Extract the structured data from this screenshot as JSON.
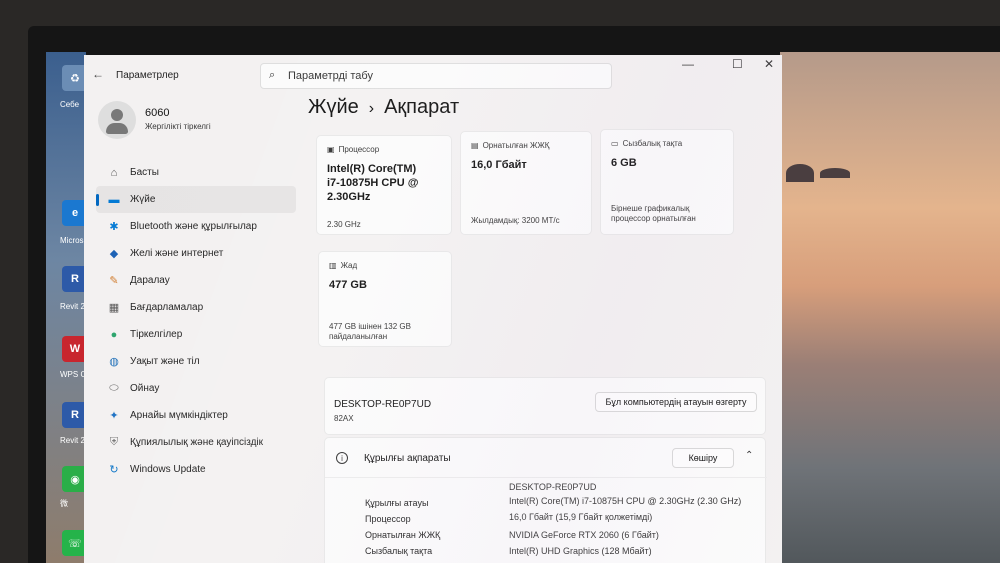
{
  "window": {
    "app_title": "Параметрлер",
    "search_placeholder": "Параметрді табу"
  },
  "user": {
    "name": "6060",
    "account_type": "Жергілікті тіркелгі"
  },
  "sidebar": {
    "items": [
      {
        "label": "Басты",
        "icon": "home-icon"
      },
      {
        "label": "Жүйе",
        "icon": "system-icon",
        "active": true
      },
      {
        "label": "Bluetooth және құрылғылар",
        "icon": "bluetooth-icon"
      },
      {
        "label": "Желі және интернет",
        "icon": "wifi-icon"
      },
      {
        "label": "Даралау",
        "icon": "brush-icon"
      },
      {
        "label": "Бағдарламалар",
        "icon": "apps-icon"
      },
      {
        "label": "Тіркелгілер",
        "icon": "person-icon"
      },
      {
        "label": "Уақыт және тіл",
        "icon": "globe-clock-icon"
      },
      {
        "label": "Ойнау",
        "icon": "gamepad-icon"
      },
      {
        "label": "Арнайы мүмкіндіктер",
        "icon": "accessibility-icon"
      },
      {
        "label": "Құпиялылық және қауіпсіздік",
        "icon": "shield-icon"
      },
      {
        "label": "Windows Update",
        "icon": "update-icon"
      }
    ]
  },
  "breadcrumb": {
    "parent": "Жүйе",
    "separator": "›",
    "current": "Ақпарат"
  },
  "cards": {
    "processor": {
      "label": "Процессор",
      "value_line1": "Intel(R) Core(TM)",
      "value_line2": "i7-10875H CPU @",
      "value_line3": "2.30GHz",
      "sub": "2.30 GHz"
    },
    "ram": {
      "label": "Орнатылған ЖЖҚ",
      "value": "16,0 Гбайт",
      "sub": "Жылдамдық: 3200 MT/c"
    },
    "gpu": {
      "label": "Сызбалық тақта",
      "value": "6 GB",
      "sub_line1": "Бірнеше графикалық",
      "sub_line2": "процессор орнатылған"
    },
    "storage": {
      "label": "Жад",
      "value": "477 GB",
      "sub_line1": "477 GB ішінен 132 GB",
      "sub_line2": "пайдаланылған"
    }
  },
  "device": {
    "name": "DESKTOP-RE0P7UD",
    "model": "82AX",
    "rename_label": "Бұл компьютердің атауын өзгерту"
  },
  "specs": {
    "title": "Құрылғы ақпараты",
    "copy_label": "Көшіру",
    "rows": [
      {
        "key": "",
        "value": "DESKTOP-RE0P7UD"
      },
      {
        "key": "Құрылғы атауы",
        "value": "Intel(R) Core(TM) i7-10875H CPU @ 2.30GHz (2.30 GHz)"
      },
      {
        "key": "Процессор",
        "value": "16,0 Гбайт (15,9 Гбайт қолжетімді)"
      },
      {
        "key": "Орнатылған ЖЖҚ",
        "value": "NVIDIA GeForce RTX 2060 (6 Гбайт)"
      },
      {
        "key": "Сызбалық тақта",
        "value": "Intel(R) UHD Graphics (128 Мбайт)"
      }
    ]
  },
  "desktop_icons": [
    {
      "label": "Себе",
      "color": "#5a7fa6"
    },
    {
      "label": "Micros Edg",
      "color": "#1b78d0"
    },
    {
      "label": "Revit 2",
      "color": "#2d5aa8"
    },
    {
      "label": "WPS O",
      "color": "#c8262e"
    },
    {
      "label": "Revit 2",
      "color": "#2d5aa8"
    },
    {
      "label": "微",
      "color": "#2aae48"
    }
  ]
}
